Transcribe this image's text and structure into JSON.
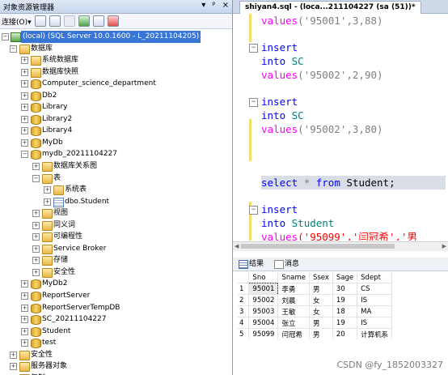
{
  "explorer": {
    "title": "对象资源管理器",
    "title_buttons": [
      "▾",
      "ᵖ",
      "×"
    ],
    "toolbar": {
      "connect_label": "连接(O)▾"
    },
    "server": "(local) (SQL Server 10.0.1600 - L_20211104205)",
    "nodes": {
      "databases": "数据库",
      "system_dbs": "系统数据库",
      "snapshots": "数据库快照",
      "db1": "Computer_science_department",
      "db2": "Db2",
      "db3": "Library",
      "db4": "Library2",
      "db5": "Library4",
      "db6": "MyDb",
      "db7": "mydb_20211104227",
      "diagrams": "数据库关系图",
      "tables": "表",
      "system_tables": "系统表",
      "student_table": "dbo.Student",
      "views": "视图",
      "synonyms": "同义词",
      "programmability": "可编程性",
      "service_broker": "Service Broker",
      "storage": "存储",
      "security_inner": "安全性",
      "db8": "MyDb2",
      "db9": "ReportServer",
      "db10": "ReportServerTempDB",
      "db11": "SC_20211104227",
      "db12": "Student",
      "db13": "test",
      "security": "安全性",
      "server_objects": "服务器对象",
      "more": "复制"
    }
  },
  "editor": {
    "tab_title": "shiyan4.sql - (loca...211104227 (sa (51))*",
    "code": {
      "l1_fn": "values",
      "l1_args": "('95001',3,88)",
      "l2_kw": "insert",
      "l3_kw": "into",
      "l3_t": "SC",
      "l4_fn": "values",
      "l4_args": "('95002',2,90)",
      "l5_kw": "insert",
      "l6_kw": "into",
      "l6_t": "SC",
      "l7_fn": "values",
      "l7_args": "('95002',3,80)",
      "l8_select": "select",
      "l8_star": "*",
      "l8_from": "from",
      "l8_table": "Student;",
      "l9_kw": "insert",
      "l10_kw": "into",
      "l10_t": "Student",
      "l11_fn": "values",
      "l11_args": "('95099','闫冠希','男"
    },
    "results_tabs": [
      "结果",
      "消息"
    ],
    "columns": [
      "Sno",
      "Sname",
      "Ssex",
      "Sage",
      "Sdept"
    ],
    "rows": [
      [
        "1",
        "95001",
        "李勇",
        "男",
        "30",
        "CS"
      ],
      [
        "2",
        "95002",
        "刘晨",
        "女",
        "19",
        "IS"
      ],
      [
        "3",
        "95003",
        "王敏",
        "女",
        "18",
        "MA"
      ],
      [
        "4",
        "95004",
        "张立",
        "男",
        "19",
        "IS"
      ],
      [
        "5",
        "95099",
        "闫冠希",
        "男",
        "20",
        "计算机系"
      ]
    ]
  },
  "watermark": "CSDN @fy_1852003327",
  "colors": {
    "keyword": "#0000ff",
    "string": "#ff0000",
    "function": "#ff00ff",
    "selection": "#3875d7"
  }
}
